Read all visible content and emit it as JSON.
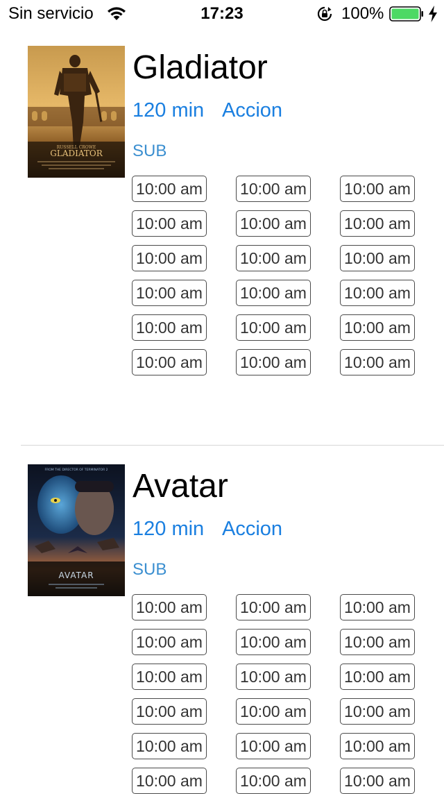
{
  "status_bar": {
    "carrier": "Sin servicio",
    "time": "17:23",
    "battery_percent": "100%",
    "battery_color": "#4cd964",
    "icons": [
      "wifi-icon",
      "rotation-lock-icon",
      "battery-icon",
      "charging-bolt-icon"
    ]
  },
  "colors": {
    "link_blue": "#1a7fe0",
    "format_blue": "#3b8fd0",
    "separator": "#d6d6d6"
  },
  "movies": [
    {
      "title": "Gladiator",
      "duration": "120 min",
      "genre": "Accion",
      "format": "SUB",
      "poster_lettering": "GLADIATOR",
      "showtimes": [
        "10:00 am",
        "10:00 am",
        "10:00 am",
        "10:00 am",
        "10:00 am",
        "10:00 am",
        "10:00 am",
        "10:00 am",
        "10:00 am",
        "10:00 am",
        "10:00 am",
        "10:00 am",
        "10:00 am",
        "10:00 am",
        "10:00 am",
        "10:00 am",
        "10:00 am",
        "10:00 am"
      ]
    },
    {
      "title": "Avatar",
      "duration": "120 min",
      "genre": "Accion",
      "format": "SUB",
      "poster_lettering": "AVATAR",
      "showtimes": [
        "10:00 am",
        "10:00 am",
        "10:00 am",
        "10:00 am",
        "10:00 am",
        "10:00 am",
        "10:00 am",
        "10:00 am",
        "10:00 am",
        "10:00 am",
        "10:00 am",
        "10:00 am",
        "10:00 am",
        "10:00 am",
        "10:00 am",
        "10:00 am",
        "10:00 am",
        "10:00 am"
      ]
    }
  ]
}
